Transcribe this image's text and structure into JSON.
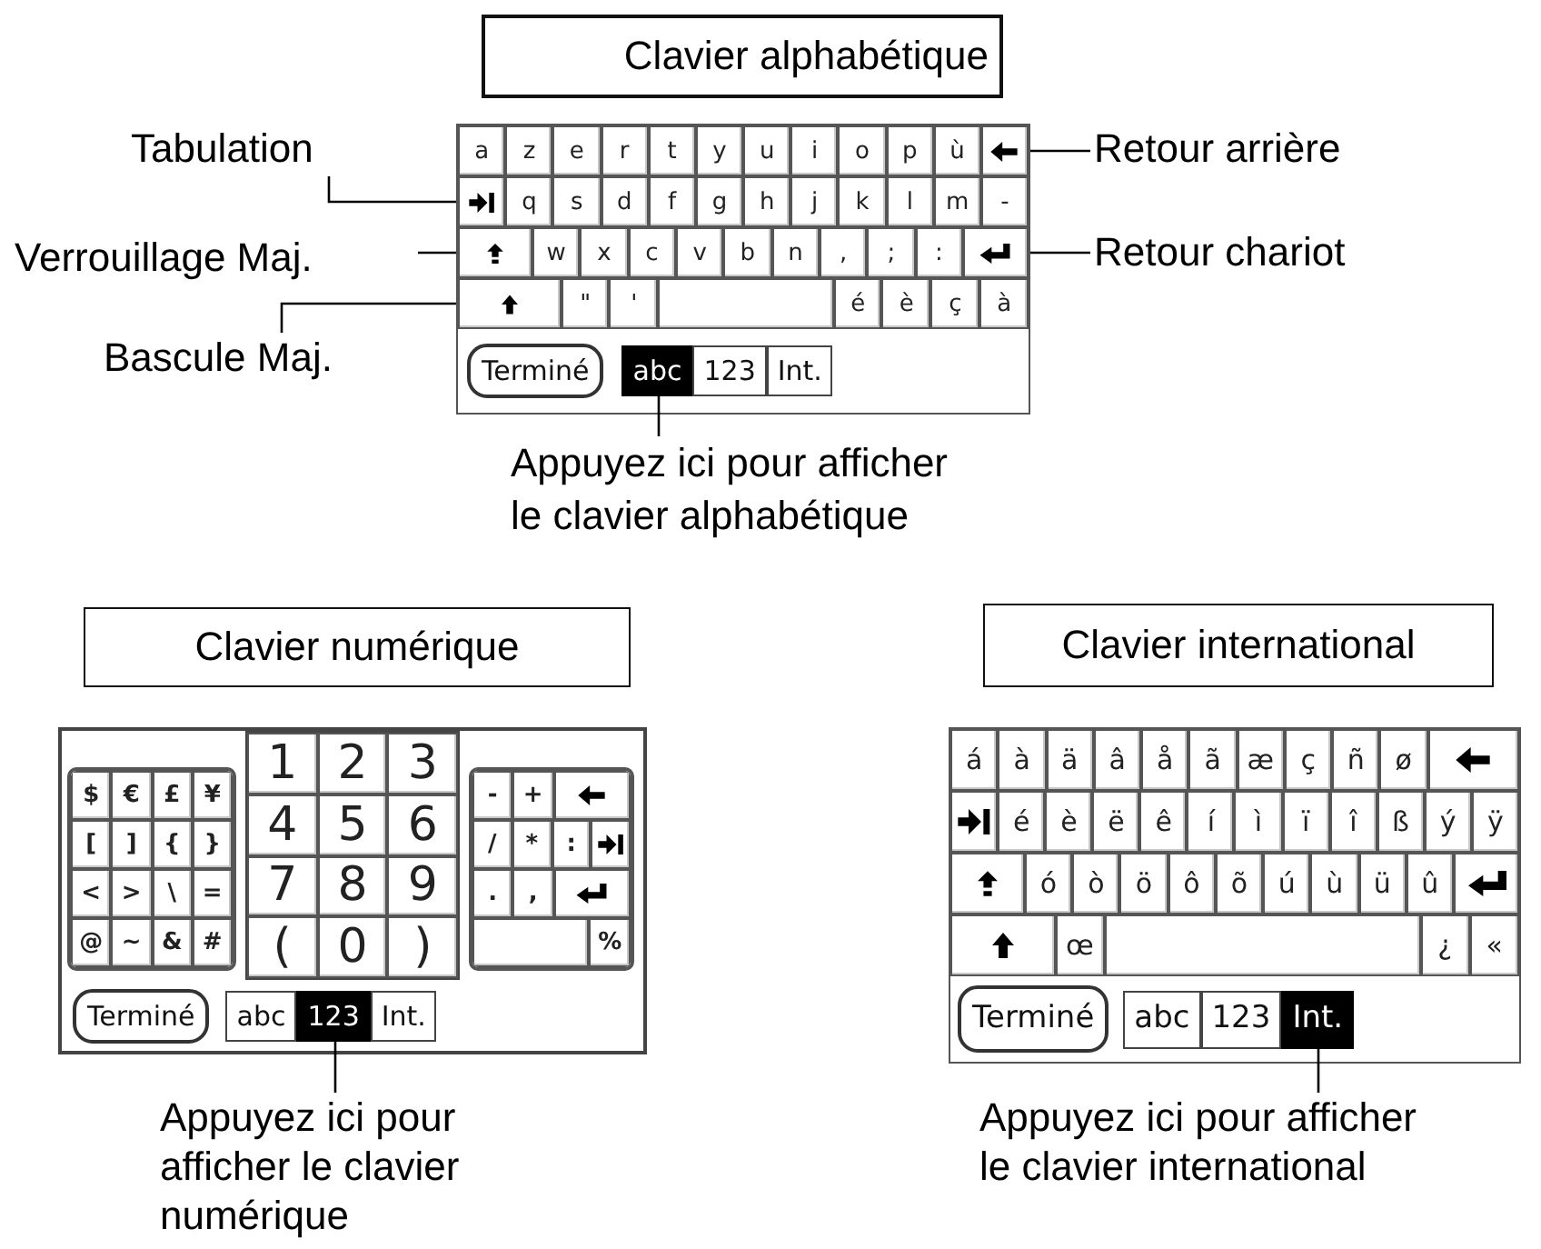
{
  "panels": [
    {
      "kind": "alpha",
      "title": "Clavier alphabétique",
      "key_groups": [
        {
          "kind": "letters",
          "rows": [
            {
              "keys": [
                {
                  "kind": "char",
                  "label": "a"
                },
                {
                  "kind": "char",
                  "label": "z"
                },
                {
                  "kind": "char",
                  "label": "e"
                },
                {
                  "kind": "char",
                  "label": "r"
                },
                {
                  "kind": "char",
                  "label": "t"
                },
                {
                  "kind": "char",
                  "label": "y"
                },
                {
                  "kind": "char",
                  "label": "u"
                },
                {
                  "kind": "char",
                  "label": "i"
                },
                {
                  "kind": "char",
                  "label": "o"
                },
                {
                  "kind": "char",
                  "label": "p"
                },
                {
                  "kind": "char",
                  "label": "ù"
                },
                {
                  "kind": "backspace"
                }
              ]
            },
            {
              "keys": [
                {
                  "kind": "tab"
                },
                {
                  "kind": "char",
                  "label": "q"
                },
                {
                  "kind": "char",
                  "label": "s"
                },
                {
                  "kind": "char",
                  "label": "d"
                },
                {
                  "kind": "char",
                  "label": "f"
                },
                {
                  "kind": "char",
                  "label": "g"
                },
                {
                  "kind": "char",
                  "label": "h"
                },
                {
                  "kind": "char",
                  "label": "j"
                },
                {
                  "kind": "char",
                  "label": "k"
                },
                {
                  "kind": "char",
                  "label": "l"
                },
                {
                  "kind": "char",
                  "label": "m"
                },
                {
                  "kind": "char",
                  "label": "-"
                }
              ]
            },
            {
              "keys": [
                {
                  "kind": "caps_lock"
                },
                {
                  "kind": "char",
                  "label": "w"
                },
                {
                  "kind": "char",
                  "label": "x"
                },
                {
                  "kind": "char",
                  "label": "c"
                },
                {
                  "kind": "char",
                  "label": "v"
                },
                {
                  "kind": "char",
                  "label": "b"
                },
                {
                  "kind": "char",
                  "label": "n"
                },
                {
                  "kind": "char",
                  "label": ","
                },
                {
                  "kind": "char",
                  "label": ";"
                },
                {
                  "kind": "char",
                  "label": ":"
                },
                {
                  "kind": "return"
                }
              ]
            },
            {
              "keys": [
                {
                  "kind": "shift"
                },
                {
                  "kind": "char",
                  "label": "\""
                },
                {
                  "kind": "char",
                  "label": "'"
                },
                {
                  "kind": "space"
                },
                {
                  "kind": "char",
                  "label": "é"
                },
                {
                  "kind": "char",
                  "label": "è"
                },
                {
                  "kind": "char",
                  "label": "ç"
                },
                {
                  "kind": "char",
                  "label": "à"
                }
              ]
            }
          ]
        }
      ],
      "done_button": "Terminé",
      "mode_tabs": [
        {
          "label": "abc",
          "selected": true
        },
        {
          "label": "123",
          "selected": false
        },
        {
          "label": "Int.",
          "selected": false
        }
      ],
      "callouts": [
        "Tabulation",
        "Retour arrière",
        "Verrouillage Maj.",
        "Retour chariot",
        "Bascule Maj."
      ],
      "caption_lines": [
        "Appuyez ici pour afficher",
        "le clavier alphabétique"
      ]
    },
    {
      "kind": "numeric",
      "title": "Clavier numérique",
      "key_groups": [
        {
          "kind": "symbols",
          "rows": [
            {
              "keys": [
                {
                  "kind": "char",
                  "label": "$"
                },
                {
                  "kind": "char",
                  "label": "€"
                },
                {
                  "kind": "char",
                  "label": "£"
                },
                {
                  "kind": "char",
                  "label": "¥"
                }
              ]
            },
            {
              "keys": [
                {
                  "kind": "char",
                  "label": "["
                },
                {
                  "kind": "char",
                  "label": "]"
                },
                {
                  "kind": "char",
                  "label": "{"
                },
                {
                  "kind": "char",
                  "label": "}"
                }
              ]
            },
            {
              "keys": [
                {
                  "kind": "char",
                  "label": "<"
                },
                {
                  "kind": "char",
                  "label": ">"
                },
                {
                  "kind": "char",
                  "label": "\\"
                },
                {
                  "kind": "char",
                  "label": "="
                }
              ]
            },
            {
              "keys": [
                {
                  "kind": "char",
                  "label": "@"
                },
                {
                  "kind": "char",
                  "label": "~"
                },
                {
                  "kind": "char",
                  "label": "&"
                },
                {
                  "kind": "char",
                  "label": "#"
                }
              ]
            }
          ]
        },
        {
          "kind": "digits",
          "rows": [
            {
              "keys": [
                {
                  "kind": "char",
                  "label": "1"
                },
                {
                  "kind": "char",
                  "label": "2"
                },
                {
                  "kind": "char",
                  "label": "3"
                }
              ]
            },
            {
              "keys": [
                {
                  "kind": "char",
                  "label": "4"
                },
                {
                  "kind": "char",
                  "label": "5"
                },
                {
                  "kind": "char",
                  "label": "6"
                }
              ]
            },
            {
              "keys": [
                {
                  "kind": "char",
                  "label": "7"
                },
                {
                  "kind": "char",
                  "label": "8"
                },
                {
                  "kind": "char",
                  "label": "9"
                }
              ]
            },
            {
              "keys": [
                {
                  "kind": "char",
                  "label": "("
                },
                {
                  "kind": "char",
                  "label": "0"
                },
                {
                  "kind": "char",
                  "label": ")"
                }
              ]
            }
          ]
        },
        {
          "kind": "operators",
          "rows": [
            {
              "keys": [
                {
                  "kind": "char",
                  "label": "-"
                },
                {
                  "kind": "char",
                  "label": "+"
                },
                {
                  "kind": "backspace"
                }
              ]
            },
            {
              "keys": [
                {
                  "kind": "char",
                  "label": "/"
                },
                {
                  "kind": "char",
                  "label": "*"
                },
                {
                  "kind": "char",
                  "label": ":"
                },
                {
                  "kind": "tab"
                }
              ]
            },
            {
              "keys": [
                {
                  "kind": "char",
                  "label": "."
                },
                {
                  "kind": "char",
                  "label": ","
                },
                {
                  "kind": "return"
                }
              ]
            },
            {
              "keys": [
                {
                  "kind": "space"
                },
                {
                  "kind": "char",
                  "label": "%"
                }
              ]
            }
          ]
        }
      ],
      "done_button": "Terminé",
      "mode_tabs": [
        {
          "label": "abc",
          "selected": false
        },
        {
          "label": "123",
          "selected": true
        },
        {
          "label": "Int.",
          "selected": false
        }
      ],
      "caption_lines": [
        "Appuyez ici pour",
        "afficher le clavier",
        "numérique"
      ]
    },
    {
      "kind": "international",
      "title": "Clavier international",
      "key_groups": [
        {
          "kind": "letters",
          "rows": [
            {
              "keys": [
                {
                  "kind": "char",
                  "label": "á"
                },
                {
                  "kind": "char",
                  "label": "à"
                },
                {
                  "kind": "char",
                  "label": "ä"
                },
                {
                  "kind": "char",
                  "label": "â"
                },
                {
                  "kind": "char",
                  "label": "å"
                },
                {
                  "kind": "char",
                  "label": "ã"
                },
                {
                  "kind": "char",
                  "label": "æ"
                },
                {
                  "kind": "char",
                  "label": "ç"
                },
                {
                  "kind": "char",
                  "label": "ñ"
                },
                {
                  "kind": "char",
                  "label": "ø"
                },
                {
                  "kind": "backspace"
                }
              ]
            },
            {
              "keys": [
                {
                  "kind": "tab"
                },
                {
                  "kind": "char",
                  "label": "é"
                },
                {
                  "kind": "char",
                  "label": "è"
                },
                {
                  "kind": "char",
                  "label": "ë"
                },
                {
                  "kind": "char",
                  "label": "ê"
                },
                {
                  "kind": "char",
                  "label": "í"
                },
                {
                  "kind": "char",
                  "label": "ì"
                },
                {
                  "kind": "char",
                  "label": "ï"
                },
                {
                  "kind": "char",
                  "label": "î"
                },
                {
                  "kind": "char",
                  "label": "ß"
                },
                {
                  "kind": "char",
                  "label": "ý"
                },
                {
                  "kind": "char",
                  "label": "ÿ"
                }
              ]
            },
            {
              "keys": [
                {
                  "kind": "caps_lock"
                },
                {
                  "kind": "char",
                  "label": "ó"
                },
                {
                  "kind": "char",
                  "label": "ò"
                },
                {
                  "kind": "char",
                  "label": "ö"
                },
                {
                  "kind": "char",
                  "label": "ô"
                },
                {
                  "kind": "char",
                  "label": "õ"
                },
                {
                  "kind": "char",
                  "label": "ú"
                },
                {
                  "kind": "char",
                  "label": "ù"
                },
                {
                  "kind": "char",
                  "label": "ü"
                },
                {
                  "kind": "char",
                  "label": "û"
                },
                {
                  "kind": "return"
                }
              ]
            },
            {
              "keys": [
                {
                  "kind": "shift"
                },
                {
                  "kind": "char",
                  "label": "œ"
                },
                {
                  "kind": "space"
                },
                {
                  "kind": "char",
                  "label": "¿"
                },
                {
                  "kind": "char",
                  "label": "«"
                }
              ]
            }
          ]
        }
      ],
      "done_button": "Terminé",
      "mode_tabs": [
        {
          "label": "abc",
          "selected": false
        },
        {
          "label": "123",
          "selected": false
        },
        {
          "label": "Int.",
          "selected": true
        }
      ],
      "caption_lines": [
        "Appuyez ici pour afficher",
        "le clavier international"
      ]
    }
  ]
}
